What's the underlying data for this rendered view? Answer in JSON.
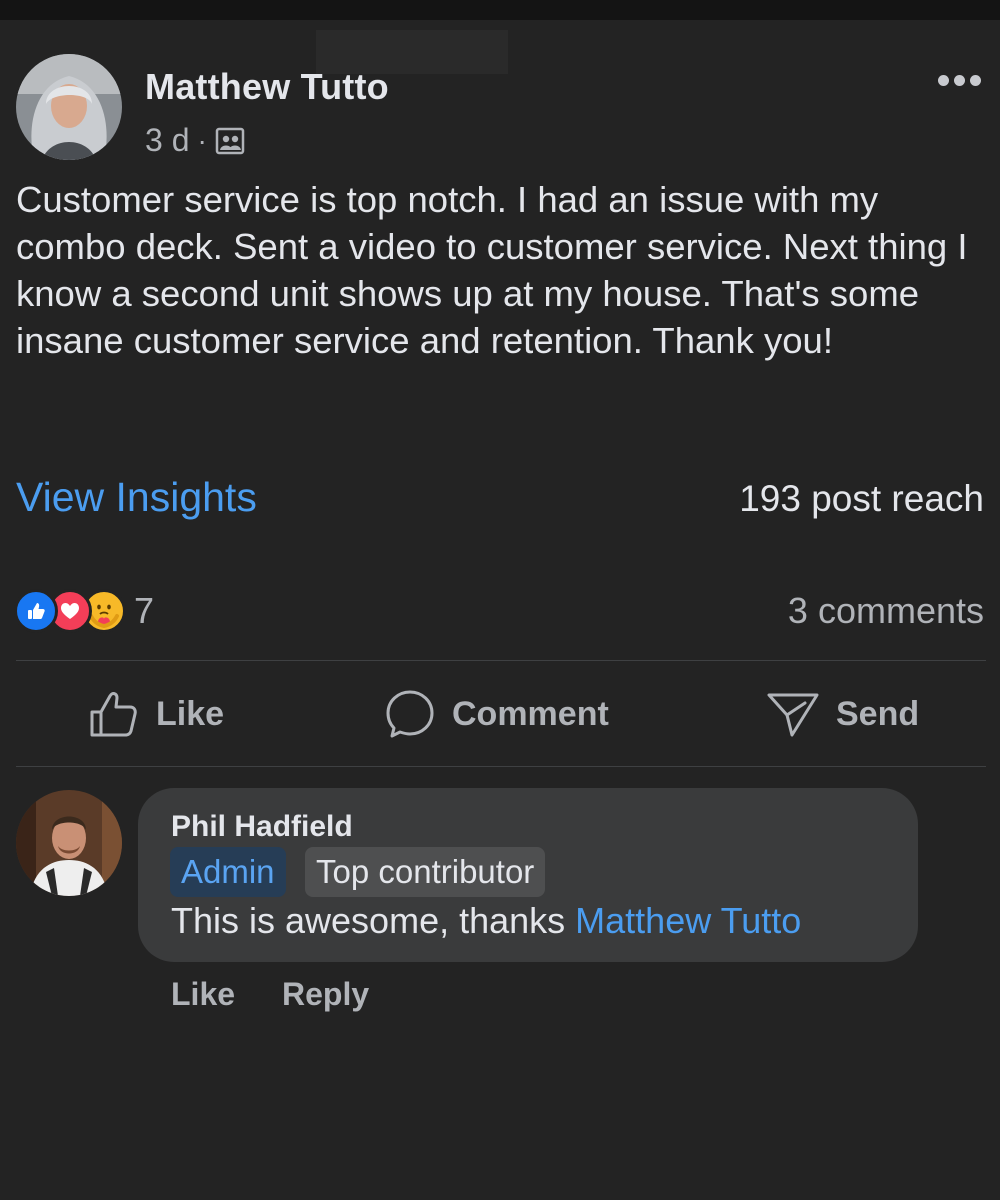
{
  "post": {
    "author": "Matthew Tutto",
    "time": "3 d",
    "separator": "·",
    "audience_icon": "group-members-icon",
    "more_icon": "more-options-icon",
    "text": "Customer service is top notch. I had an issue with my combo deck. Sent a video to customer service. Next thing I know a second unit shows up at my house. That's some insane customer service and retention. Thank you!",
    "view_insights": "View Insights",
    "post_reach": "193 post reach",
    "reactions": {
      "icons": [
        "like-reaction-icon",
        "love-reaction-icon",
        "care-reaction-icon"
      ],
      "count": "7"
    },
    "comments_count": "3 comments"
  },
  "actions": {
    "like": "Like",
    "comment": "Comment",
    "send": "Send"
  },
  "comment": {
    "author": "Phil Hadfield",
    "badges": [
      "Admin",
      "Top contributor"
    ],
    "text": "This is awesome, thanks ",
    "mention": "Matthew Tutto",
    "like": "Like",
    "reply": "Reply"
  },
  "colors": {
    "background": "#232323",
    "link_blue": "#4b9df0",
    "bubble": "#3a3b3c",
    "like_blue": "#1877f2",
    "love_red": "#f33e58",
    "care_yellow": "#f7b928"
  }
}
